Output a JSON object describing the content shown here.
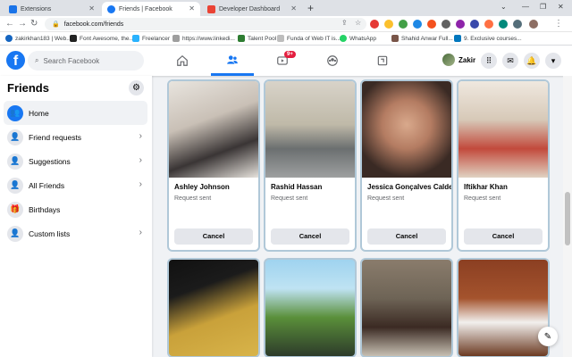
{
  "browser": {
    "tabs": [
      {
        "title": "Extensions"
      },
      {
        "title": "Friends | Facebook"
      },
      {
        "title": "Developer Dashboard"
      }
    ],
    "url": "facebook.com/friends",
    "bookmarks": [
      "zakirkhan183 | Web...",
      "Font Awesome, the...",
      "Freelancer",
      "https://www.linkedi...",
      "Talent Pool",
      "Funda of Web IT is...",
      "WhatsApp",
      "Shahid Anwar Full...",
      "9. Exclusive courses..."
    ]
  },
  "header": {
    "logo": "f",
    "search_placeholder": "Search Facebook",
    "watch_badge": "9+",
    "profile_name": "Zakir"
  },
  "sidebar": {
    "title": "Friends",
    "items": [
      {
        "label": "Home"
      },
      {
        "label": "Friend requests"
      },
      {
        "label": "Suggestions"
      },
      {
        "label": "All Friends"
      },
      {
        "label": "Birthdays"
      },
      {
        "label": "Custom lists"
      }
    ]
  },
  "cards": [
    {
      "name": "Ashley Johnson",
      "status": "Request sent",
      "button": "Cancel"
    },
    {
      "name": "Rashid Hassan",
      "status": "Request sent",
      "button": "Cancel"
    },
    {
      "name": "Jessica Gonçalves Caldei",
      "status": "Request sent",
      "button": "Cancel"
    },
    {
      "name": "Iftikhar Khan",
      "status": "Request sent",
      "button": "Cancel"
    }
  ],
  "colors": {
    "accent": "#1877f2",
    "badge": "#e41e3f"
  }
}
